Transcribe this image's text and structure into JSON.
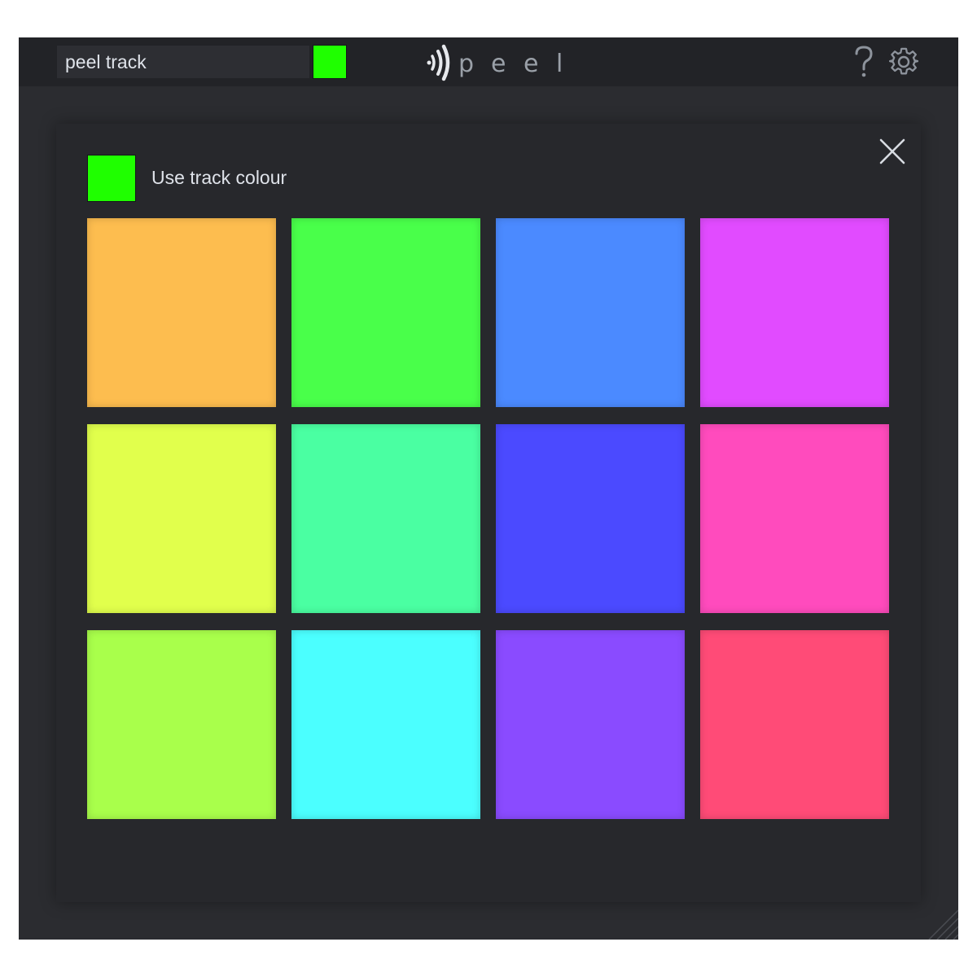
{
  "top_bar": {
    "track_name": "peel track",
    "track_colour": "#1fff00",
    "logo_letters": [
      "p",
      "e",
      "e",
      "l"
    ],
    "help_icon": "question-mark-icon",
    "settings_icon": "gear-icon"
  },
  "colour_panel": {
    "close_icon": "close-icon",
    "use_track_colour_label": "Use track colour",
    "use_track_colour_swatch": "#1fff00",
    "swatches": [
      "#fdbd4f",
      "#49ff4a",
      "#4b8aff",
      "#e14bff",
      "#e1ff4c",
      "#4affa2",
      "#4b4aff",
      "#ff4bbd",
      "#a9ff4b",
      "#4bffff",
      "#8a4bff",
      "#ff4b77"
    ]
  },
  "theme": {
    "window_bg": "#2b2c30",
    "panel_bg": "#27282c",
    "text": "#dfe3ea",
    "icon": "#8d939c"
  }
}
